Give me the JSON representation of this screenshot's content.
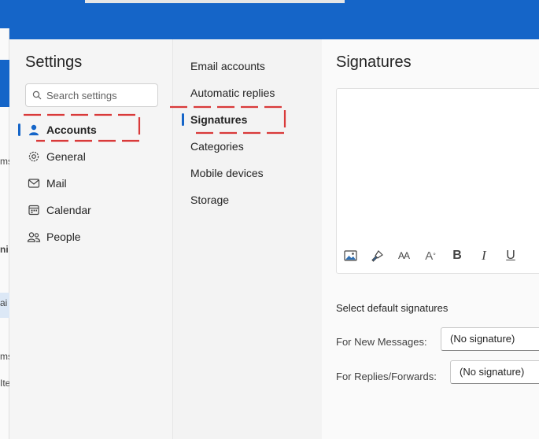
{
  "background_app": {
    "fragments": [
      "ms",
      "ni",
      "ai",
      "ms",
      "Ite"
    ]
  },
  "settings": {
    "title": "Settings",
    "search_placeholder": "Search settings",
    "nav": [
      {
        "label": "Accounts",
        "icon": "person-icon",
        "active": true
      },
      {
        "label": "General",
        "icon": "gear-icon",
        "active": false
      },
      {
        "label": "Mail",
        "icon": "mail-icon",
        "active": false
      },
      {
        "label": "Calendar",
        "icon": "calendar-icon",
        "active": false
      },
      {
        "label": "People",
        "icon": "people-icon",
        "active": false
      }
    ]
  },
  "accounts_nav": [
    {
      "label": "Email accounts",
      "active": false
    },
    {
      "label": "Automatic replies",
      "active": false
    },
    {
      "label": "Signatures",
      "active": true
    },
    {
      "label": "Categories",
      "active": false
    },
    {
      "label": "Mobile devices",
      "active": false
    },
    {
      "label": "Storage",
      "active": false
    }
  ],
  "signatures": {
    "title": "Signatures",
    "toolbar": [
      "image-icon",
      "format-painter-icon",
      "font-size-icon",
      "font-superscript-icon",
      "bold-icon",
      "italic-icon",
      "underline-icon"
    ],
    "toolbar_text": {
      "font_size": "AA",
      "superscript": "A",
      "bold": "B",
      "italic": "I",
      "underline": "U"
    },
    "default_section": "Select default signatures",
    "new_messages_label": "For New Messages:",
    "new_messages_value": "(No signature)",
    "replies_label": "For Replies/Forwards:",
    "replies_value": "(No signature)"
  },
  "colors": {
    "accent": "#1565c8",
    "annotation": "#d93a3a"
  }
}
